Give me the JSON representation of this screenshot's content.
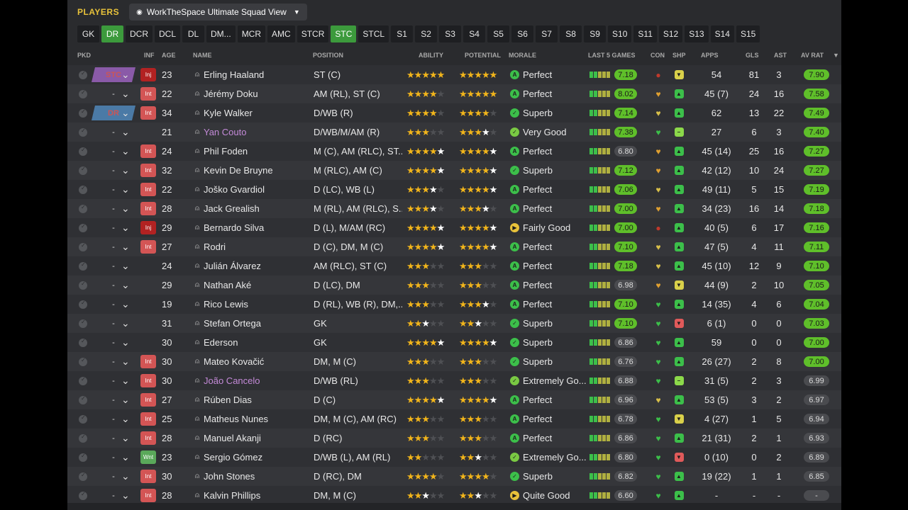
{
  "header": {
    "title": "PLAYERS",
    "view_name": "WorkTheSpace Ultimate Squad View"
  },
  "position_tabs": [
    {
      "label": "GK",
      "active": false
    },
    {
      "label": "DR",
      "active": true
    },
    {
      "label": "DCR",
      "active": false
    },
    {
      "label": "DCL",
      "active": false
    },
    {
      "label": "DL",
      "active": false
    },
    {
      "label": "DM...",
      "active": false
    },
    {
      "label": "MCR",
      "active": false
    },
    {
      "label": "AMC",
      "active": false
    },
    {
      "label": "STCR",
      "active": false
    },
    {
      "label": "STC",
      "active": true
    },
    {
      "label": "STCL",
      "active": false
    },
    {
      "label": "S1",
      "active": false
    },
    {
      "label": "S2",
      "active": false
    },
    {
      "label": "S3",
      "active": false
    },
    {
      "label": "S4",
      "active": false
    },
    {
      "label": "S5",
      "active": false
    },
    {
      "label": "S6",
      "active": false
    },
    {
      "label": "S7",
      "active": false
    },
    {
      "label": "S8",
      "active": false
    },
    {
      "label": "S9",
      "active": false
    },
    {
      "label": "S10",
      "active": false
    },
    {
      "label": "S11",
      "active": false
    },
    {
      "label": "S12",
      "active": false
    },
    {
      "label": "S13",
      "active": false
    },
    {
      "label": "S14",
      "active": false
    },
    {
      "label": "S15",
      "active": false
    }
  ],
  "columns": {
    "pkd": "PKD",
    "inf": "INF",
    "age": "AGE",
    "name": "NAME",
    "position": "POSITION",
    "ability": "ABILITY",
    "potential": "POTENTIAL",
    "morale": "MORALE",
    "last5": "LAST 5 GAMES",
    "con": "CON",
    "shp": "SHP",
    "apps": "APPS",
    "gls": "GLS",
    "ast": "AST",
    "avrat": "AV RAT"
  },
  "players": [
    {
      "sel": "STC",
      "inf": "Inj",
      "age": "23",
      "name": "Erling Haaland",
      "loan": false,
      "position": "ST (C)",
      "ability": 5,
      "potential": 5,
      "morale": "Perfect",
      "morale_icon": "perfect",
      "last5": "7.18",
      "last5_hi": true,
      "con": "injury-dot",
      "shp": "mid",
      "apps": "54",
      "gls": "81",
      "ast": "3",
      "avrat": "7.90",
      "avrat_hi": true
    },
    {
      "sel": "-",
      "inf": "Int",
      "age": "22",
      "name": "Jérémy Doku",
      "loan": false,
      "position": "AM (RL), ST (C)",
      "ability": 4,
      "potential": 5,
      "morale": "Perfect",
      "morale_icon": "perfect",
      "last5": "8.02",
      "last5_hi": true,
      "con": "heart-orange",
      "shp": "good",
      "apps": "45 (7)",
      "gls": "24",
      "ast": "16",
      "avrat": "7.58",
      "avrat_hi": true
    },
    {
      "sel": "DR",
      "inf": "Int",
      "age": "34",
      "name": "Kyle Walker",
      "loan": false,
      "position": "D/WB (R)",
      "ability": 4,
      "potential": 4,
      "morale": "Superb",
      "morale_icon": "superb",
      "last5": "7.14",
      "last5_hi": true,
      "con": "heart-yellow",
      "shp": "good",
      "apps": "62",
      "gls": "13",
      "ast": "22",
      "avrat": "7.49",
      "avrat_hi": true
    },
    {
      "sel": "-",
      "inf": "",
      "age": "21",
      "name": "Yan Couto",
      "loan": true,
      "position": "D/WB/M/AM (R)",
      "ability": 3,
      "potential": 3.5,
      "morale": "Very Good",
      "morale_icon": "vgood",
      "last5": "7.38",
      "last5_hi": true,
      "con": "heart-green",
      "shp": "ok",
      "apps": "27",
      "gls": "6",
      "ast": "3",
      "avrat": "7.40",
      "avrat_hi": true
    },
    {
      "sel": "-",
      "inf": "Int",
      "age": "24",
      "name": "Phil Foden",
      "loan": false,
      "position": "M (C), AM (RLC), ST...",
      "ability": 4.5,
      "potential": 4.5,
      "morale": "Perfect",
      "morale_icon": "perfect",
      "last5": "6.80",
      "last5_hi": false,
      "con": "heart-orange",
      "shp": "good",
      "apps": "45 (14)",
      "gls": "25",
      "ast": "16",
      "avrat": "7.27",
      "avrat_hi": true
    },
    {
      "sel": "-",
      "inf": "Int",
      "age": "32",
      "name": "Kevin De Bruyne",
      "loan": false,
      "position": "M (RLC), AM (C)",
      "ability": 4.5,
      "potential": 4.5,
      "morale": "Superb",
      "morale_icon": "superb",
      "last5": "7.12",
      "last5_hi": true,
      "con": "heart-orange",
      "shp": "good",
      "apps": "42 (12)",
      "gls": "10",
      "ast": "24",
      "avrat": "7.27",
      "avrat_hi": true
    },
    {
      "sel": "-",
      "inf": "Int",
      "age": "22",
      "name": "Joško Gvardiol",
      "loan": false,
      "position": "D (LC), WB (L)",
      "ability": 3.5,
      "potential": 4.5,
      "morale": "Perfect",
      "morale_icon": "perfect",
      "last5": "7.06",
      "last5_hi": true,
      "con": "heart-yellow",
      "shp": "good",
      "apps": "49 (11)",
      "gls": "5",
      "ast": "15",
      "avrat": "7.19",
      "avrat_hi": true
    },
    {
      "sel": "-",
      "inf": "Int",
      "age": "28",
      "name": "Jack Grealish",
      "loan": false,
      "position": "M (RL), AM (RLC), S...",
      "ability": 3.5,
      "potential": 3.5,
      "morale": "Perfect",
      "morale_icon": "perfect",
      "last5": "7.00",
      "last5_hi": true,
      "con": "heart-orange",
      "shp": "good",
      "apps": "34 (23)",
      "gls": "16",
      "ast": "14",
      "avrat": "7.18",
      "avrat_hi": true
    },
    {
      "sel": "-",
      "inf": "Inj",
      "age": "29",
      "name": "Bernardo Silva",
      "loan": false,
      "position": "D (L), M/AM (RC)",
      "ability": 4.5,
      "potential": 4.5,
      "morale": "Fairly Good",
      "morale_icon": "fgood",
      "last5": "7.00",
      "last5_hi": true,
      "con": "injury-dot",
      "shp": "good",
      "apps": "40 (5)",
      "gls": "6",
      "ast": "17",
      "avrat": "7.16",
      "avrat_hi": true
    },
    {
      "sel": "-",
      "inf": "Int",
      "age": "27",
      "name": "Rodri",
      "loan": false,
      "position": "D (C), DM, M (C)",
      "ability": 4.5,
      "potential": 4.5,
      "morale": "Perfect",
      "morale_icon": "perfect",
      "last5": "7.10",
      "last5_hi": true,
      "con": "heart-yellow",
      "shp": "good",
      "apps": "47 (5)",
      "gls": "4",
      "ast": "11",
      "avrat": "7.11",
      "avrat_hi": true
    },
    {
      "sel": "-",
      "inf": "",
      "age": "24",
      "name": "Julián Álvarez",
      "loan": false,
      "position": "AM (RLC), ST (C)",
      "ability": 3,
      "potential": 3,
      "morale": "Perfect",
      "morale_icon": "perfect",
      "last5": "7.18",
      "last5_hi": true,
      "con": "heart-yellow",
      "shp": "good",
      "apps": "45 (10)",
      "gls": "12",
      "ast": "9",
      "avrat": "7.10",
      "avrat_hi": true
    },
    {
      "sel": "-",
      "inf": "",
      "age": "29",
      "name": "Nathan Aké",
      "loan": false,
      "position": "D (LC), DM",
      "ability": 3,
      "potential": 3,
      "morale": "Perfect",
      "morale_icon": "perfect",
      "last5": "6.98",
      "last5_hi": false,
      "con": "heart-orange",
      "shp": "mid",
      "apps": "44 (9)",
      "gls": "2",
      "ast": "10",
      "avrat": "7.05",
      "avrat_hi": true
    },
    {
      "sel": "-",
      "inf": "",
      "age": "19",
      "name": "Rico Lewis",
      "loan": false,
      "position": "D (RL), WB (R), DM,...",
      "ability": 3,
      "potential": 3.5,
      "morale": "Perfect",
      "morale_icon": "perfect",
      "last5": "7.10",
      "last5_hi": true,
      "con": "heart-green",
      "shp": "good",
      "apps": "14 (35)",
      "gls": "4",
      "ast": "6",
      "avrat": "7.04",
      "avrat_hi": true
    },
    {
      "sel": "-",
      "inf": "",
      "age": "31",
      "name": "Stefan Ortega",
      "loan": false,
      "position": "GK",
      "ability": 2.5,
      "potential": 2.5,
      "morale": "Superb",
      "morale_icon": "superb",
      "last5": "7.10",
      "last5_hi": true,
      "con": "heart-green",
      "shp": "bad",
      "apps": "6 (1)",
      "gls": "0",
      "ast": "0",
      "avrat": "7.03",
      "avrat_hi": true
    },
    {
      "sel": "-",
      "inf": "",
      "age": "30",
      "name": "Ederson",
      "loan": false,
      "position": "GK",
      "ability": 4.5,
      "potential": 4.5,
      "morale": "Superb",
      "morale_icon": "superb",
      "last5": "6.86",
      "last5_hi": false,
      "con": "heart-green",
      "shp": "good",
      "apps": "59",
      "gls": "0",
      "ast": "0",
      "avrat": "7.00",
      "avrat_hi": true
    },
    {
      "sel": "-",
      "inf": "Int",
      "age": "30",
      "name": "Mateo Kovačić",
      "loan": false,
      "position": "DM, M (C)",
      "ability": 3,
      "potential": 3,
      "morale": "Superb",
      "morale_icon": "superb",
      "last5": "6.76",
      "last5_hi": false,
      "con": "heart-green",
      "shp": "good",
      "apps": "26 (27)",
      "gls": "2",
      "ast": "8",
      "avrat": "7.00",
      "avrat_hi": true
    },
    {
      "sel": "-",
      "inf": "Int",
      "age": "30",
      "name": "João Cancelo",
      "loan": true,
      "position": "D/WB (RL)",
      "ability": 3,
      "potential": 3,
      "morale": "Extremely Go...",
      "morale_icon": "egood",
      "last5": "6.88",
      "last5_hi": false,
      "con": "heart-green",
      "shp": "ok",
      "apps": "31 (5)",
      "gls": "2",
      "ast": "3",
      "avrat": "6.99",
      "avrat_hi": false
    },
    {
      "sel": "-",
      "inf": "Int",
      "age": "27",
      "name": "Rúben Dias",
      "loan": false,
      "position": "D (C)",
      "ability": 4.5,
      "potential": 4.5,
      "morale": "Perfect",
      "morale_icon": "perfect",
      "last5": "6.96",
      "last5_hi": false,
      "con": "heart-yellow",
      "shp": "good",
      "apps": "53 (5)",
      "gls": "3",
      "ast": "2",
      "avrat": "6.97",
      "avrat_hi": false
    },
    {
      "sel": "-",
      "inf": "Int",
      "age": "25",
      "name": "Matheus Nunes",
      "loan": false,
      "position": "DM, M (C), AM (RC)",
      "ability": 3,
      "potential": 3,
      "morale": "Perfect",
      "morale_icon": "perfect",
      "last5": "6.78",
      "last5_hi": false,
      "con": "heart-green",
      "shp": "mid",
      "apps": "4 (27)",
      "gls": "1",
      "ast": "5",
      "avrat": "6.94",
      "avrat_hi": false
    },
    {
      "sel": "-",
      "inf": "Int",
      "age": "28",
      "name": "Manuel Akanji",
      "loan": false,
      "position": "D (RC)",
      "ability": 3,
      "potential": 3,
      "morale": "Perfect",
      "morale_icon": "perfect",
      "last5": "6.86",
      "last5_hi": false,
      "con": "heart-green",
      "shp": "good",
      "apps": "21 (31)",
      "gls": "2",
      "ast": "1",
      "avrat": "6.93",
      "avrat_hi": false
    },
    {
      "sel": "-",
      "inf": "Wnt",
      "age": "23",
      "name": "Sergio Gómez",
      "loan": false,
      "position": "D/WB (L), AM (RL)",
      "ability": 2,
      "potential": 2.5,
      "morale": "Extremely Go...",
      "morale_icon": "egood",
      "last5": "6.80",
      "last5_hi": false,
      "con": "heart-green",
      "shp": "bad",
      "apps": "0 (10)",
      "gls": "0",
      "ast": "2",
      "avrat": "6.89",
      "avrat_hi": false
    },
    {
      "sel": "-",
      "inf": "Int",
      "age": "30",
      "name": "John Stones",
      "loan": false,
      "position": "D (RC), DM",
      "ability": 4,
      "potential": 4,
      "morale": "Superb",
      "morale_icon": "superb",
      "last5": "6.82",
      "last5_hi": false,
      "con": "heart-green",
      "shp": "good",
      "apps": "19 (22)",
      "gls": "1",
      "ast": "1",
      "avrat": "6.85",
      "avrat_hi": false
    },
    {
      "sel": "-",
      "inf": "Int",
      "age": "28",
      "name": "Kalvin Phillips",
      "loan": false,
      "position": "DM, M (C)",
      "ability": 2.5,
      "potential": 2.5,
      "morale": "Quite Good",
      "morale_icon": "qgood",
      "last5": "6.60",
      "last5_hi": false,
      "con": "heart-green",
      "shp": "good",
      "apps": "-",
      "gls": "-",
      "ast": "-",
      "avrat": "-",
      "avrat_hi": false
    }
  ],
  "colors": {
    "accent_gold": "#e8c23a",
    "tab_active": "#3c9a3c",
    "rating_high": "#5fbf2a"
  }
}
